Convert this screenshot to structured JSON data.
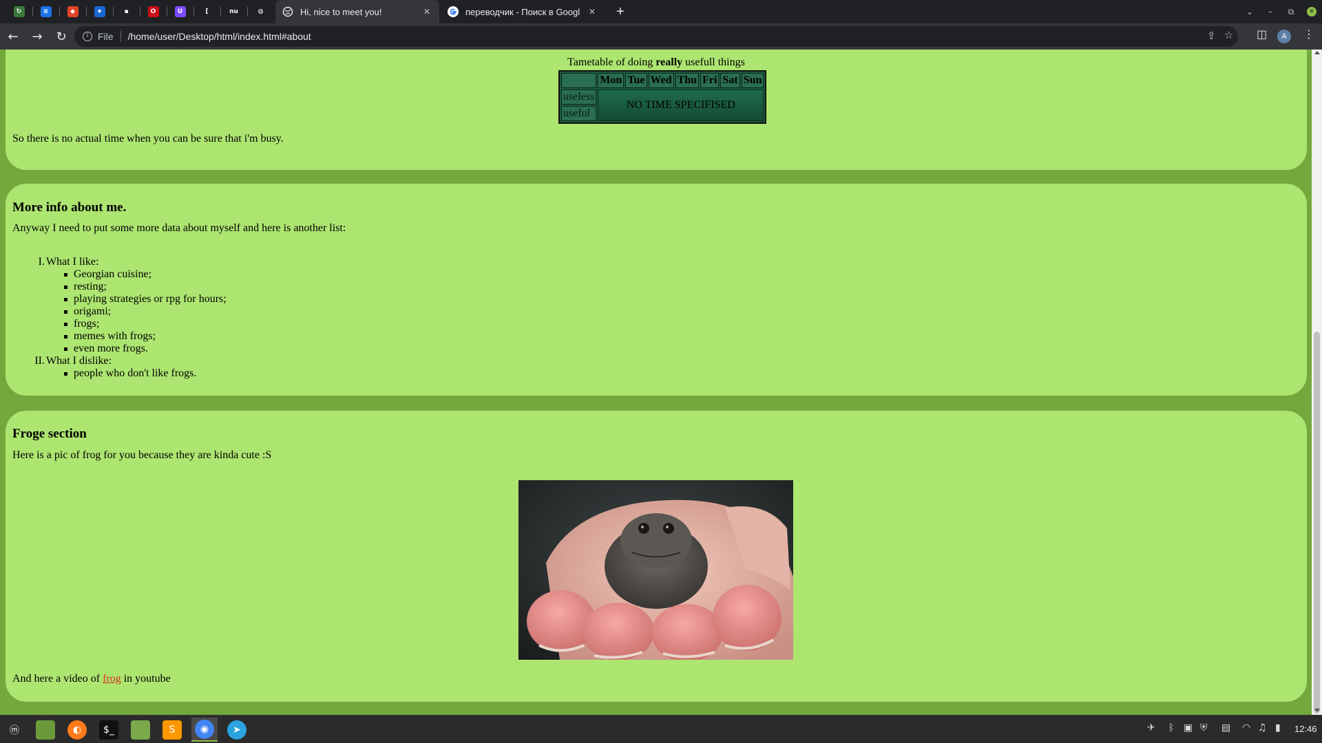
{
  "browser": {
    "pinned_tabs": [
      {
        "icon": "refresh-swirl-icon",
        "color": "#3a7a3a",
        "glyph": "↻"
      },
      {
        "icon": "document-blue-icon",
        "color": "#1a73e8",
        "glyph": "≡"
      },
      {
        "icon": "gitlab-icon",
        "color": "#e24329",
        "glyph": "◆"
      },
      {
        "icon": "star-app-icon",
        "color": "#1967d2",
        "glyph": "★"
      },
      {
        "icon": "chat-icon",
        "color": "#202124",
        "glyph": "▪"
      },
      {
        "icon": "opera-icon",
        "color": "#cc0f16",
        "glyph": "O"
      },
      {
        "icon": "shield-app-icon",
        "color": "#7b4dff",
        "glyph": "U"
      },
      {
        "icon": "bracket-icon",
        "color": "#202124",
        "glyph": "["
      },
      {
        "icon": "nu-icon",
        "color": "#202124",
        "glyph": "nu"
      },
      {
        "icon": "globe-icon",
        "color": "#202124",
        "glyph": "◍"
      }
    ],
    "tabs": [
      {
        "title": "Hi, nice to meet you!",
        "icon": "globe-icon",
        "active": true
      },
      {
        "title": "переводчик - Поиск в Googl",
        "icon": "google-icon",
        "active": false
      }
    ],
    "new_tab": "+",
    "window_controls": {
      "dropdown": "⌄",
      "minimize": "–",
      "restore": "⧉",
      "close": "✕"
    },
    "nav": {
      "back": "←",
      "forward": "→",
      "reload": "↻"
    },
    "address": {
      "scheme": "File",
      "url": "/home/user/Desktop/html/index.html#about"
    },
    "profile_initial": "A"
  },
  "page": {
    "schedule": {
      "caption_pre": "Tametable of doing ",
      "caption_bold": "really",
      "caption_post": " usefull things",
      "days": [
        "Mon",
        "Tue",
        "Wed",
        "Thu",
        "Fri",
        "Sat",
        "Sun"
      ],
      "rows": [
        "useless",
        "useful"
      ],
      "span_text": "NO TIME SPECIFISED",
      "note": "So there is no actual time when you can be sure that i'm busy."
    },
    "info": {
      "title": "More info about me.",
      "intro": "Anyway I need to put some more data about myself and here is another list:",
      "groups": [
        {
          "num": "I.",
          "label": "What I like:",
          "items": [
            "Georgian cuisine;",
            "resting;",
            "playing strategies or rpg for hours;",
            "origami;",
            "frogs;",
            "memes with frogs;",
            "even more frogs."
          ]
        },
        {
          "num": "II.",
          "label": "What I dislike:",
          "items": [
            "people who don't like frogs."
          ]
        }
      ]
    },
    "frog": {
      "title": "Froge section",
      "intro": "Here is a pic of frog for you because they are kinda cute :S",
      "video_pre": "And here a video of ",
      "video_link": "frog",
      "video_post": " in youtube"
    }
  },
  "taskbar": {
    "apps": [
      {
        "name": "mint-menu-icon",
        "color": "#2b2b2b",
        "glyph": "ⓜ"
      },
      {
        "name": "folder-green-icon",
        "color": "#6a9a3a",
        "glyph": ""
      },
      {
        "name": "firefox-icon",
        "color": "#ff7a1a",
        "glyph": "◐"
      },
      {
        "name": "terminal-icon",
        "color": "#111111",
        "glyph": "$_"
      },
      {
        "name": "files-icon",
        "color": "#7aa84a",
        "glyph": ""
      },
      {
        "name": "sublime-icon",
        "color": "#ff9800",
        "glyph": "S"
      },
      {
        "name": "chrome-icon",
        "color": "#4285f4",
        "glyph": "◉"
      },
      {
        "name": "telegram-icon",
        "color": "#2aa3df",
        "glyph": "➤"
      }
    ],
    "tray": [
      {
        "name": "telegram-tray-icon",
        "glyph": "✈"
      },
      {
        "name": "bluetooth-icon",
        "glyph": "ᛒ"
      },
      {
        "name": "clipboard-icon",
        "glyph": "▣"
      },
      {
        "name": "shield-tray-icon",
        "glyph": "⛨"
      },
      {
        "name": "flag-us-icon",
        "glyph": "▤"
      },
      {
        "name": "wifi-icon",
        "glyph": "◠"
      },
      {
        "name": "music-icon",
        "glyph": "♫"
      },
      {
        "name": "battery-icon",
        "glyph": "▮"
      }
    ],
    "clock": "12:46"
  }
}
